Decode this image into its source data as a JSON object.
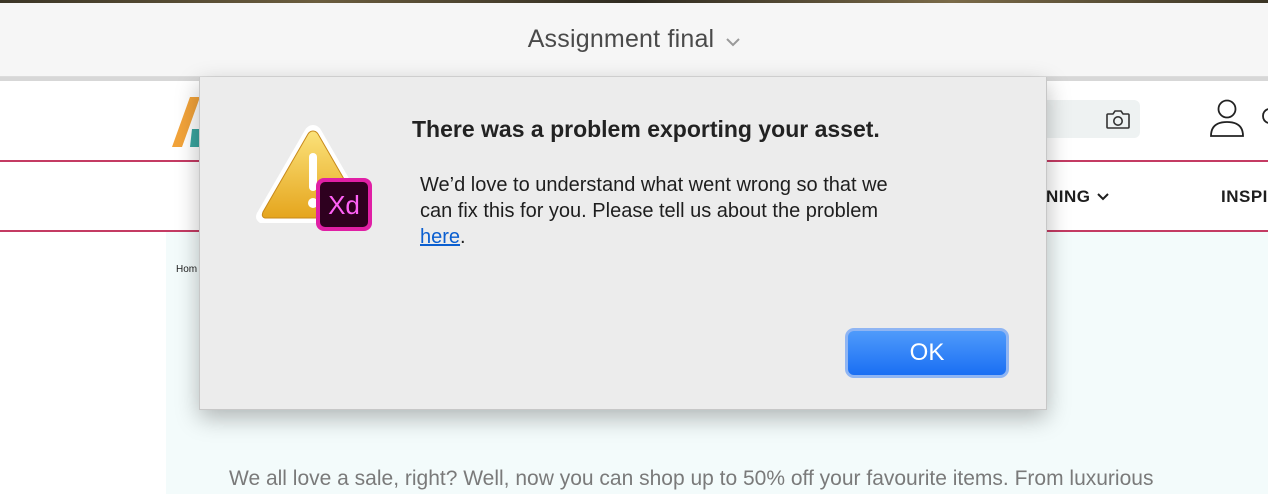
{
  "window": {
    "title": "Assignment final"
  },
  "website": {
    "nav": {
      "learning_fragment": "NING",
      "inspiration_fragment": "INSPI"
    },
    "breadcrumb_fragment": "Hom",
    "intro_text": "We all love a sale, right? Well, now you can shop up to 50% off your favourite items. From luxurious"
  },
  "dialog": {
    "title": "There was a problem exporting your asset.",
    "message_line_1": "We’d love to understand what went wrong so that we",
    "message_line_2": "can fix this for you. Please tell us about the problem",
    "link_text": "here",
    "link_suffix": ".",
    "app_badge": "Xd",
    "ok_label": "OK"
  },
  "colors": {
    "accent_rule": "#c43b63",
    "xd_badge": "#e01fa5",
    "ok_button": "#1a6ff3",
    "link": "#0b5fd0"
  },
  "icons": [
    "chevron-down-icon",
    "camera-icon",
    "user-icon",
    "warning-icon",
    "adobe-xd-icon"
  ]
}
